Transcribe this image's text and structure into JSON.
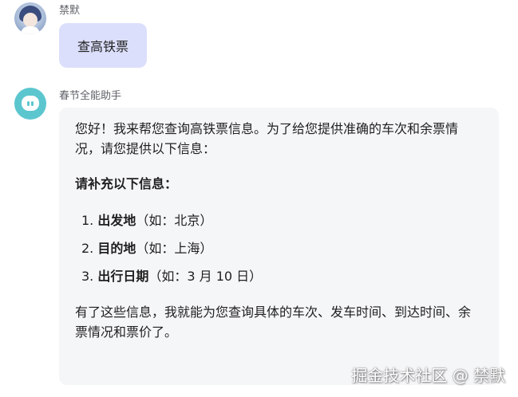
{
  "user": {
    "name": "禁默",
    "avatar_icon": "anime-avatar-icon",
    "message": "查高铁票"
  },
  "bot": {
    "name": "春节全能助手",
    "avatar_icon": "cloud-bot-icon",
    "intro": "您好！我来帮您查询高铁票信息。为了给您提供准确的车次和余票情况，请您提供以下信息：",
    "heading": "请补充以下信息：",
    "items": [
      {
        "num": "1.",
        "label": "出发地",
        "example": "（如：北京）"
      },
      {
        "num": "2.",
        "label": "目的地",
        "example": "（如：上海）"
      },
      {
        "num": "3.",
        "label": "出行日期",
        "example": "（如：3 月 10 日）"
      }
    ],
    "outro": "有了这些信息，我就能为您查询具体的车次、发车时间、到达时间、余票情况和票价了。"
  },
  "watermark": "掘金技术社区 @ 禁默",
  "colors": {
    "user_bubble": "#dcdffb",
    "bot_bubble": "#f5f6f8",
    "bot_avatar": "#5cc6cf"
  }
}
